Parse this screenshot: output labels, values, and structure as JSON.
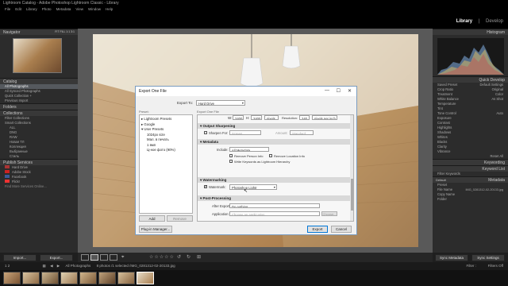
{
  "window": {
    "title": "Lightroom Catalog - Adobe Photoshop Lightroom Classic - Library"
  },
  "menu": [
    "File",
    "Edit",
    "Library",
    "Photo",
    "Metadata",
    "View",
    "Window",
    "Help"
  ],
  "modules": {
    "library": "Library",
    "develop": "Develop",
    "separator": "|"
  },
  "left": {
    "navigator": "Navigator",
    "nav_zoom": "FIT  FILL  1:1  3:1",
    "catalog": "Catalog",
    "catalog_items": [
      "All Photographs",
      "All Synced Photographs",
      "Quick Collection +",
      "Previous Import"
    ],
    "folders": "Folders",
    "collections": "Collections",
    "collection_items": [
      "Filter Collections",
      "Smart Collections",
      "ALL",
      "DNG",
      "RAW",
      "Новая ТЛ",
      "Коллекция",
      "Выбранные",
      "Стиль"
    ],
    "publish": "Publish Services",
    "publish_items": [
      "Hard Drive",
      "Adobe Stock",
      "Facebook",
      "Flickr"
    ],
    "publish_find": "Find More Services Online...",
    "import_btn": "Import...",
    "export_btn": "Export..."
  },
  "right": {
    "histogram": "Histogram",
    "quick_develop": "Quick Develop",
    "saved_preset": "Saved Preset",
    "saved_preset_value": "Default Settings",
    "crop_ratio": "Crop Ratio",
    "crop_ratio_value": "Original",
    "treatment": "Treatment",
    "treatment_value": "Color",
    "white_balance": "White Balance",
    "white_balance_value": "As Shot",
    "temperature": "Temperature",
    "tint": "Tint",
    "tone_control": "Tone Control",
    "auto_label": "Auto",
    "tone_rows": [
      "Exposure",
      "Contrast",
      "Highlights",
      "Shadows",
      "Whites",
      "Blacks",
      "Clarity",
      "Vibrance"
    ],
    "reset_all": "Reset All",
    "keywording": "Keywording",
    "keyword_list": "Keyword List",
    "filter_keywords": "Filter Keywords",
    "metadata": "Metadata",
    "metadata_preset": "Default",
    "meta_rows": [
      "Preset",
      "File Name",
      "Copy Name",
      "Folder"
    ],
    "file_name": "IMG_0281312-02-20133.jpg",
    "sync_metadata": "Sync Metadata",
    "sync_settings": "Sync Settings"
  },
  "filmstrip": {
    "pages": "1 2",
    "source": "All Photographs",
    "status": "8 photos /1 selected /IMG_0281312-02-20133.jpg",
    "filter_label": "Filter :",
    "filter_value": "Filters Off"
  },
  "toolbar": {
    "stars": "☆☆☆☆☆"
  },
  "dialog": {
    "title": "Export One File",
    "export_to_label": "Export To:",
    "export_to_value": "Hard Drive",
    "preset_header": "Preset:",
    "tree": [
      "Lightroom Presets",
      "Google",
      "User Presets",
      "1024px size",
      "Мал. в печать",
      "1 вмп",
      "Ц-ное фото (90%)"
    ],
    "settings_caption": "Export One File",
    "dims_w_label": "W:",
    "dims_w": "2400",
    "dims_h_label": "H:",
    "dims_h": "2400",
    "dims_unit": "pixels",
    "resolution_label": "Resolution:",
    "resolution": "240",
    "res_unit": "pixels per inch",
    "output_sharpening": "Output Sharpening",
    "sharpen_for": "Sharpen For:",
    "sharpen_for_value": "Screen",
    "amount_label": "Amount:",
    "amount_value": "Standard",
    "metadata": "Metadata",
    "include_label": "Include:",
    "include_value": "All Metadata",
    "remove_person": "Remove Person Info",
    "remove_location": "Remove Location Info",
    "write_keywords": "Write Keywords as Lightroom Hierarchy",
    "watermarking": "Watermarking",
    "watermark_label": "Watermark:",
    "watermark_value": "Photoshop Lightr",
    "post_processing": "Post-Processing",
    "after_export_label": "After Export:",
    "after_export_value": "Do nothing",
    "application_label": "Application:",
    "application_value": "Choose an application...",
    "choose_btn": "Choose...",
    "add_btn": "Add",
    "remove_btn": "Remove",
    "plugin_btn": "Plug-in Manager...",
    "export_btn": "Export",
    "cancel_btn": "Cancel",
    "min": "—",
    "max": "☐",
    "close": "✕"
  }
}
